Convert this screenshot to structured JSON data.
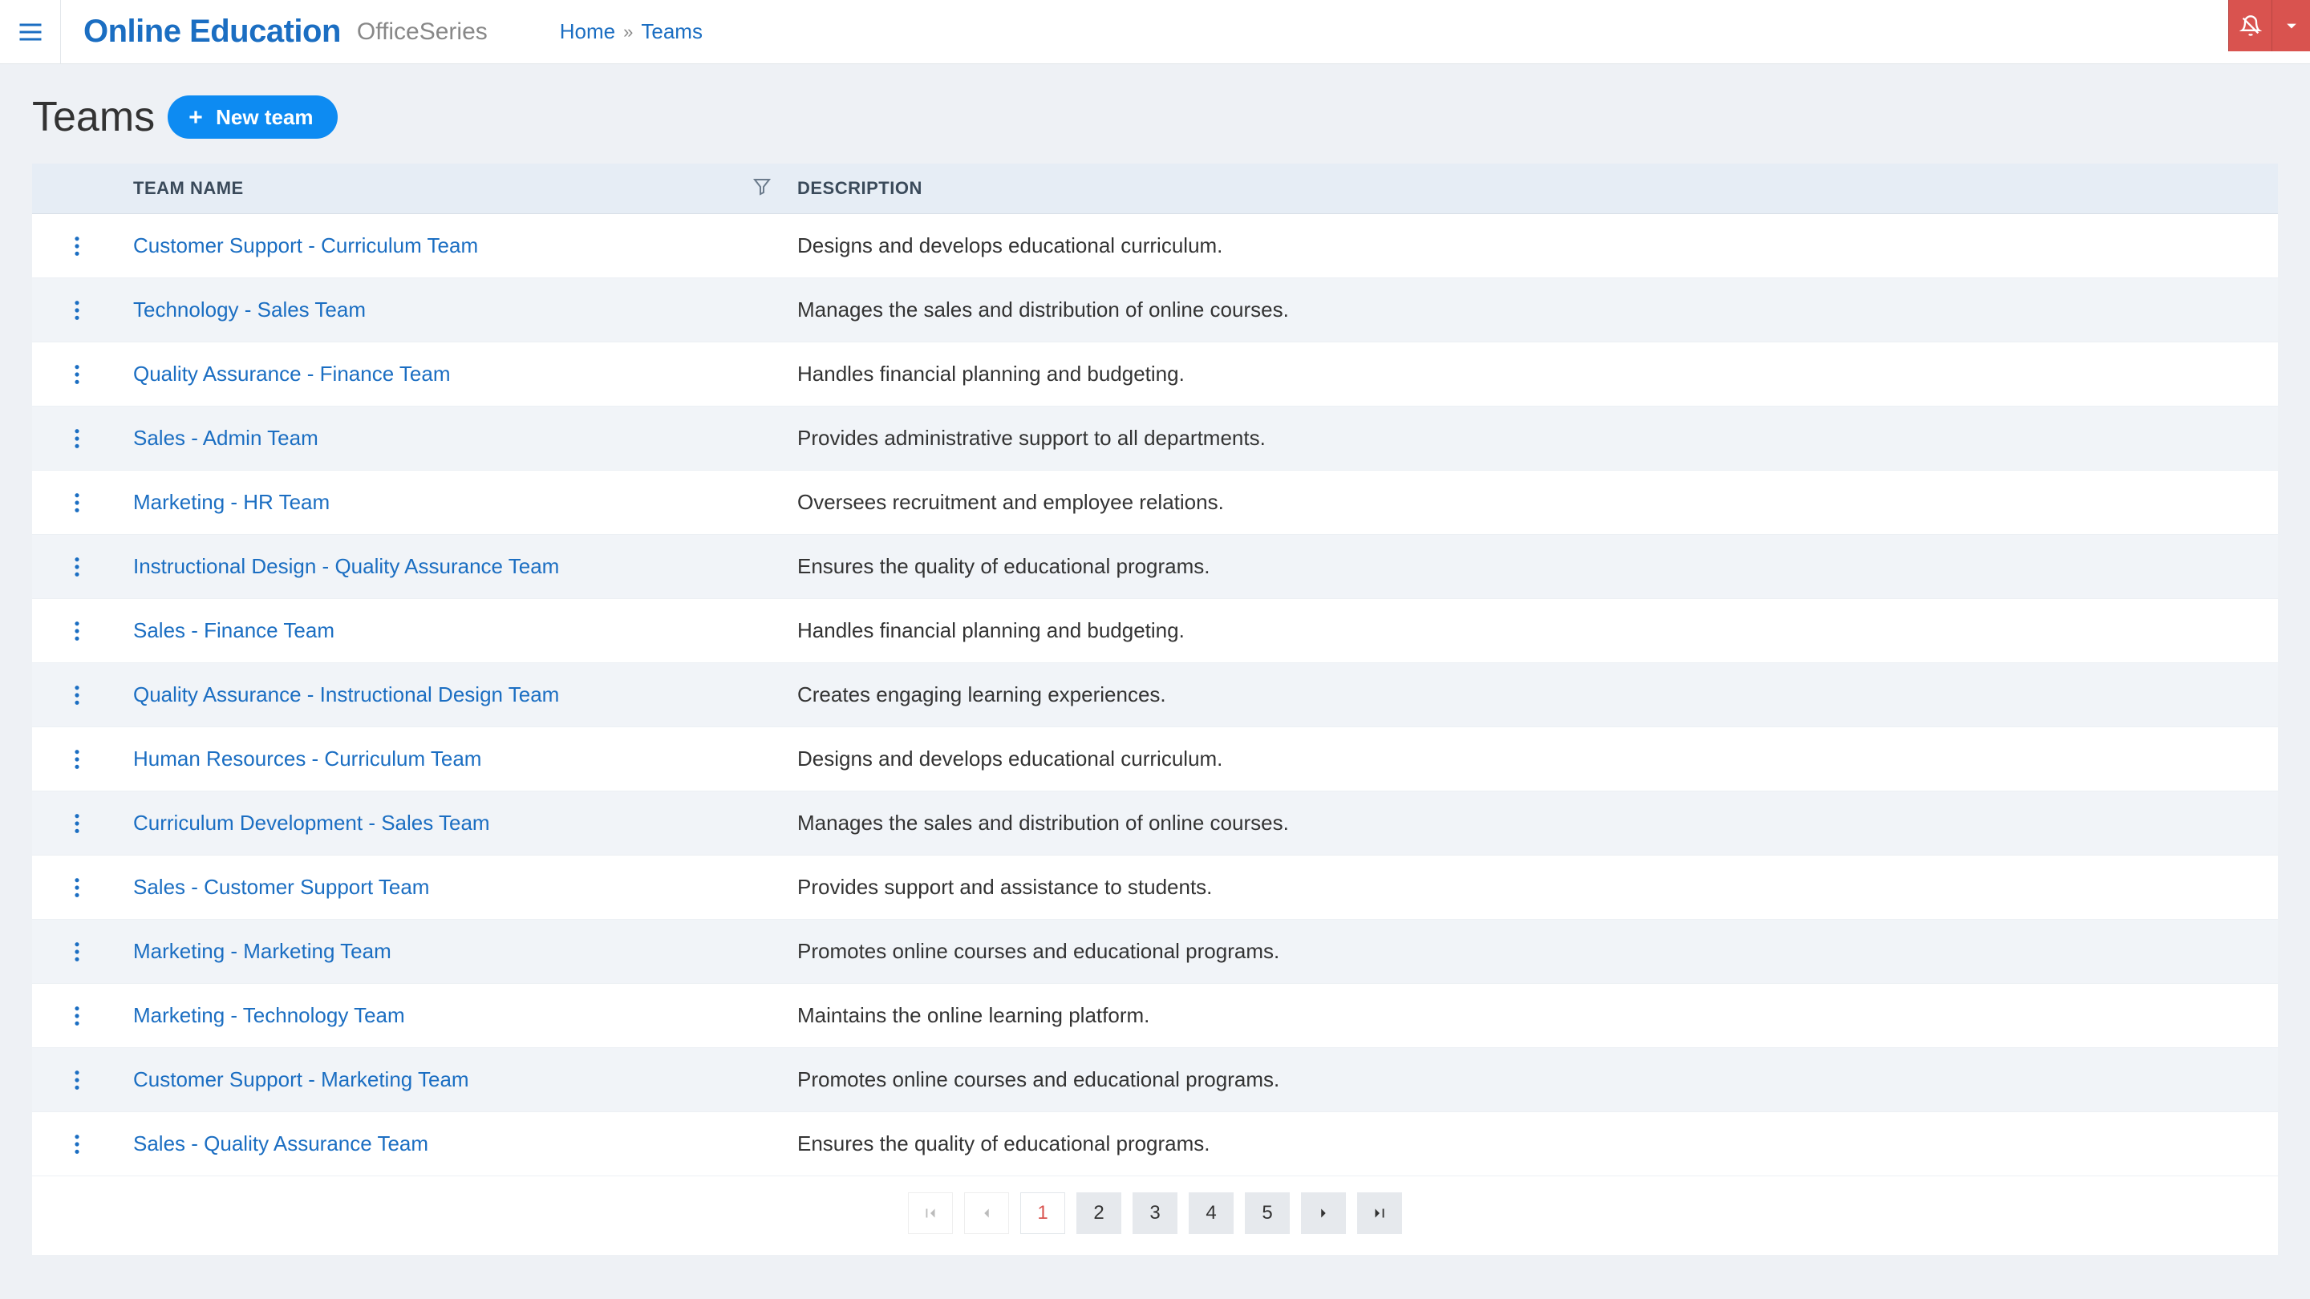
{
  "header": {
    "brand": "Online Education",
    "brand_suffix": "OfficeSeries",
    "breadcrumb": {
      "home": "Home",
      "current": "Teams"
    }
  },
  "page": {
    "title": "Teams",
    "new_team_label": "New team"
  },
  "table": {
    "columns": {
      "name": "Team Name",
      "description": "Description"
    },
    "rows": [
      {
        "name": "Customer Support - Curriculum Team",
        "description": "Designs and develops educational curriculum."
      },
      {
        "name": "Technology - Sales Team",
        "description": "Manages the sales and distribution of online courses."
      },
      {
        "name": "Quality Assurance - Finance Team",
        "description": "Handles financial planning and budgeting."
      },
      {
        "name": "Sales - Admin Team",
        "description": "Provides administrative support to all departments."
      },
      {
        "name": "Marketing - HR Team",
        "description": "Oversees recruitment and employee relations."
      },
      {
        "name": "Instructional Design - Quality Assurance Team",
        "description": "Ensures the quality of educational programs."
      },
      {
        "name": "Sales - Finance Team",
        "description": "Handles financial planning and budgeting."
      },
      {
        "name": "Quality Assurance - Instructional Design Team",
        "description": "Creates engaging learning experiences."
      },
      {
        "name": "Human Resources - Curriculum Team",
        "description": "Designs and develops educational curriculum."
      },
      {
        "name": "Curriculum Development - Sales Team",
        "description": "Manages the sales and distribution of online courses."
      },
      {
        "name": "Sales - Customer Support Team",
        "description": "Provides support and assistance to students."
      },
      {
        "name": "Marketing - Marketing Team",
        "description": "Promotes online courses and educational programs."
      },
      {
        "name": "Marketing - Technology Team",
        "description": "Maintains the online learning platform."
      },
      {
        "name": "Customer Support - Marketing Team",
        "description": "Promotes online courses and educational programs."
      },
      {
        "name": "Sales - Quality Assurance Team",
        "description": "Ensures the quality of educational programs."
      }
    ]
  },
  "pagination": {
    "pages": [
      "1",
      "2",
      "3",
      "4",
      "5"
    ],
    "current": "1"
  }
}
